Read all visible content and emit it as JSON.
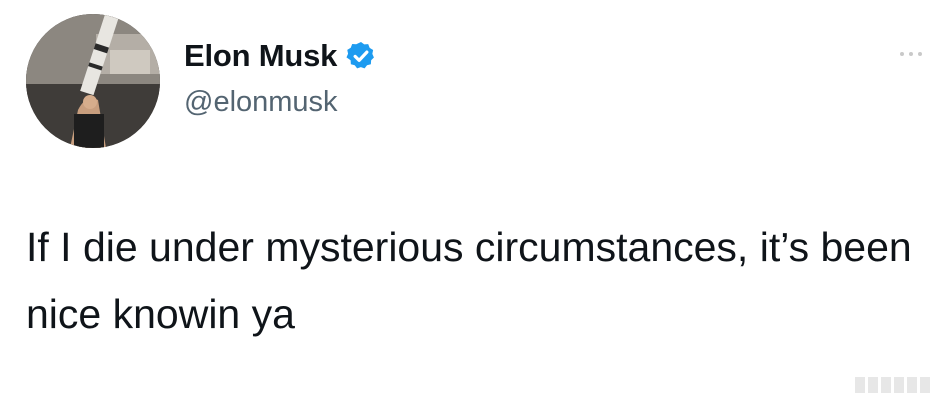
{
  "tweet": {
    "display_name": "Elon Musk",
    "handle": "@elonmusk",
    "verified": true,
    "text": "If I die under mysterious circumstances, it’s been nice knowin ya"
  },
  "icons": {
    "verified": "verified-badge-icon",
    "more": "more-options-icon"
  },
  "colors": {
    "verified_blue": "#1d9bf0",
    "text": "#0f1419",
    "handle_gray": "#536471"
  }
}
